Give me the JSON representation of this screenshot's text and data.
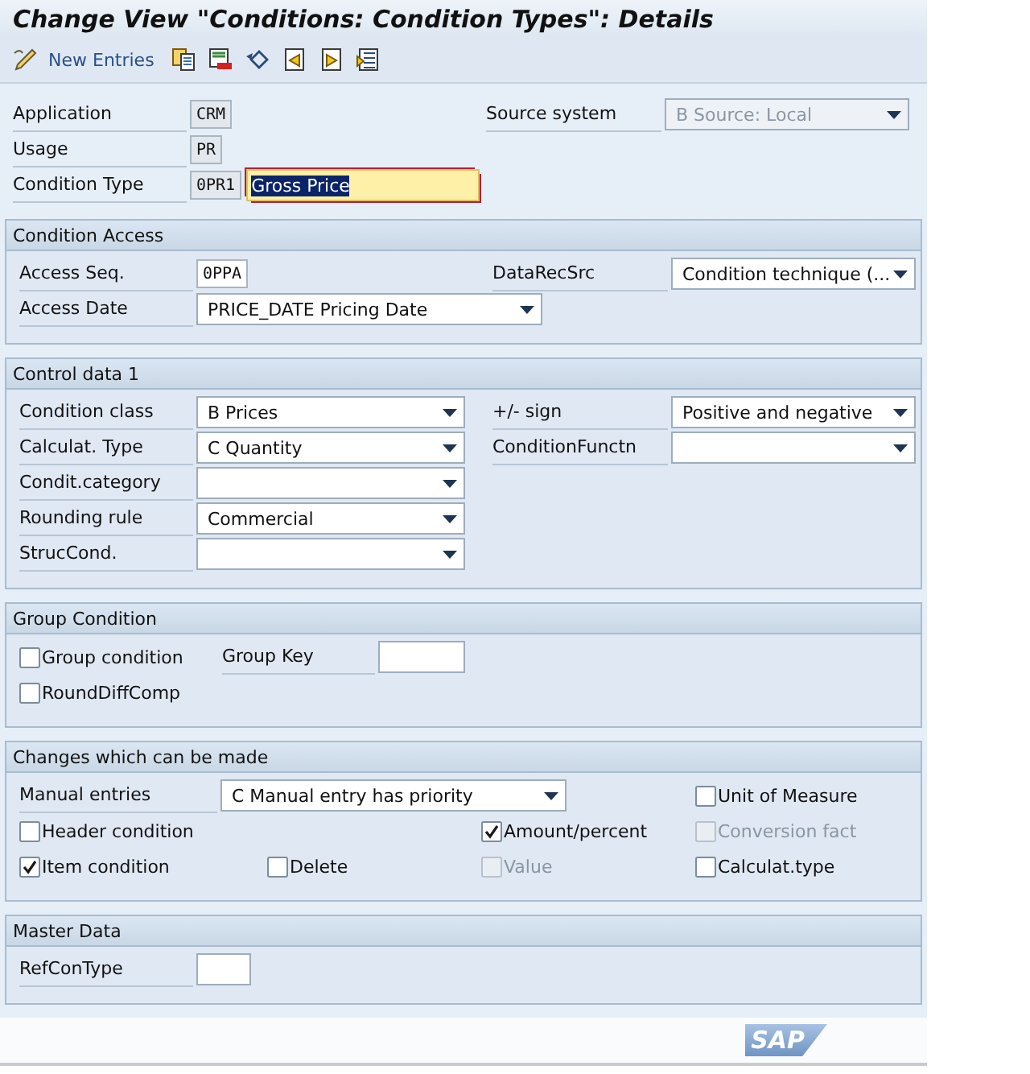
{
  "window": {
    "title": "Change View \"Conditions: Condition Types\": Details"
  },
  "toolbar": {
    "new_entries": "New Entries"
  },
  "header": {
    "rows": [
      [
        {
          "kind": "code",
          "label": "Application",
          "value": "CRM",
          "readonly": true
        },
        {
          "kind": "dropdown",
          "label": "Source system",
          "value": "B Source: Local",
          "disabled": true
        }
      ],
      [
        {
          "kind": "code",
          "label": "Usage",
          "value": "PR",
          "readonly": true
        }
      ],
      [
        {
          "kind": "code",
          "label": "Condition Type",
          "value": "0PR1",
          "readonly": true,
          "description": {
            "value": "Gross Price",
            "focused": true
          }
        }
      ]
    ]
  },
  "sections": [
    {
      "title": "Condition Access",
      "rows": [
        [
          {
            "kind": "code",
            "label": "Access Seq.",
            "value": "0PPA",
            "readonly": false
          },
          {
            "kind": "dropdown",
            "label": "DataRecSrc",
            "value": "Condition technique (...",
            "disabled": false
          }
        ],
        [
          {
            "kind": "dropdown",
            "label": "Access Date",
            "value": "PRICE_DATE Pricing Date",
            "disabled": false
          }
        ]
      ]
    },
    {
      "title": "Control data 1",
      "rows": [
        [
          {
            "kind": "dropdown",
            "label": "Condition class",
            "value": "B Prices",
            "disabled": false
          },
          {
            "kind": "dropdown",
            "label": "+/- sign",
            "value": "Positive and negative",
            "disabled": false
          }
        ],
        [
          {
            "kind": "dropdown",
            "label": "Calculat. Type",
            "value": "C Quantity",
            "disabled": false
          },
          {
            "kind": "dropdown",
            "label": "ConditionFunctn",
            "disabled": false
          }
        ],
        [
          {
            "kind": "dropdown",
            "label": "Condit.category",
            "disabled": false
          }
        ],
        [
          {
            "kind": "dropdown",
            "label": "Rounding rule",
            "value": "Commercial",
            "disabled": false
          }
        ],
        [
          {
            "kind": "dropdown",
            "label": "StrucCond.",
            "disabled": false
          }
        ]
      ]
    },
    {
      "title": "Group Condition",
      "rows": [
        [
          {
            "kind": "checkbox",
            "label": "Group condition",
            "checked": false,
            "disabled": false
          },
          {
            "kind": "input",
            "label": "Group Key"
          }
        ],
        [
          {
            "kind": "checkbox",
            "label": "RoundDiffComp",
            "checked": false,
            "disabled": false
          }
        ]
      ]
    },
    {
      "title": "Changes which can be made",
      "rows": [
        [
          {
            "kind": "dropdown",
            "label": "Manual entries",
            "value": "C Manual entry has priority",
            "disabled": false
          },
          "",
          "",
          {
            "kind": "checkbox",
            "label": "Unit of Measure",
            "checked": false,
            "disabled": false
          }
        ],
        [
          {
            "kind": "checkbox",
            "label": "Header condition",
            "checked": false,
            "disabled": false
          },
          "",
          {
            "kind": "checkbox",
            "label": "Amount/percent",
            "checked": true,
            "disabled": false
          },
          {
            "kind": "checkbox",
            "label": "Conversion fact",
            "checked": false,
            "disabled": true
          }
        ],
        [
          {
            "kind": "checkbox",
            "label": "Item condition",
            "checked": true,
            "disabled": false
          },
          {
            "kind": "checkbox",
            "label": "Delete",
            "checked": false,
            "disabled": false
          },
          {
            "kind": "checkbox",
            "label": "Value",
            "checked": false,
            "disabled": true
          },
          {
            "kind": "checkbox",
            "label": "Calculat.type",
            "checked": false,
            "disabled": false
          }
        ]
      ]
    },
    {
      "title": "Master Data",
      "rows": [
        [
          {
            "kind": "input",
            "label": "RefConType"
          }
        ]
      ]
    }
  ],
  "status_bar": {
    "logo": "SAP"
  }
}
